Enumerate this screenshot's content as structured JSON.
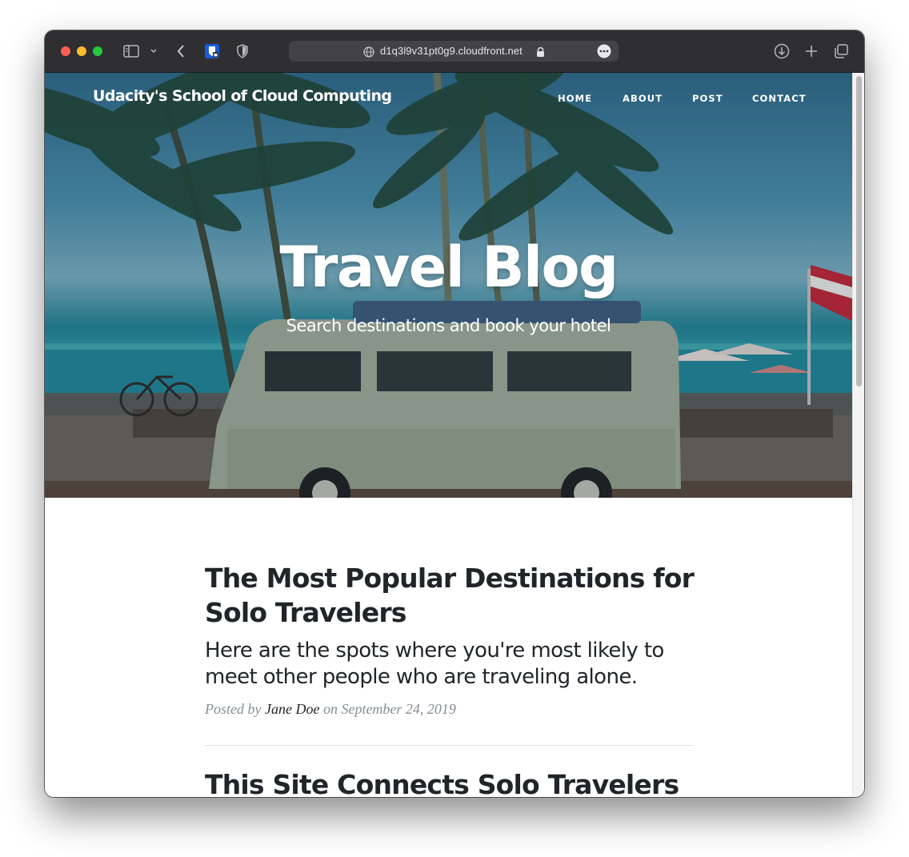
{
  "browser": {
    "url": "d1q3l9v31pt0g9.cloudfront.net",
    "icons": [
      "sidebar-icon",
      "chevron-down-icon",
      "back-icon",
      "bitwarden-icon",
      "shield-icon",
      "globe-icon",
      "lock-icon",
      "more-icon",
      "download-icon",
      "plus-icon",
      "tabs-icon"
    ]
  },
  "site": {
    "brand": "Udacity's School of Cloud Computing",
    "nav": [
      "HOME",
      "ABOUT",
      "POST",
      "CONTACT"
    ]
  },
  "hero": {
    "title": "Travel Blog",
    "subtitle": "Search destinations and book your hotel"
  },
  "posts": [
    {
      "title": "The Most Popular Destinations for Solo Travelers",
      "subtitle": "Here are the spots where you're most likely to meet other people who are traveling alone.",
      "meta_prefix": "Posted by",
      "author": "Jane Doe",
      "meta_on": "on",
      "date": "September 24, 2019"
    },
    {
      "title": "This Site Connects Solo Travelers"
    }
  ],
  "colors": {
    "text": "#212529",
    "muted": "#868e96",
    "titlebar": "#2f2f31"
  }
}
